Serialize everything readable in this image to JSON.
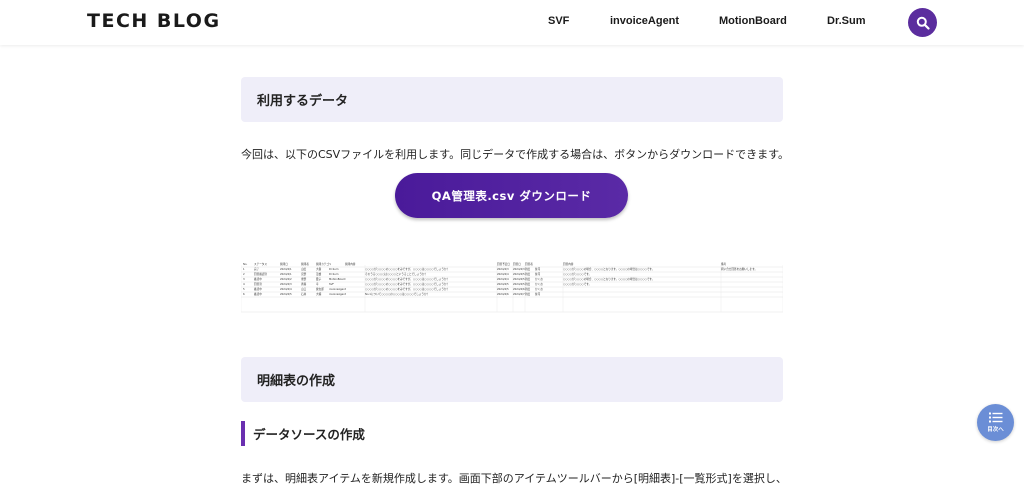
{
  "header": {
    "logo": "TECH BLOG",
    "nav": [
      "SVF",
      "invoiceAgent",
      "MotionBoard",
      "Dr.Sum"
    ],
    "search_icon": "search-icon"
  },
  "sections": {
    "data_used": "利用するデータ",
    "intro": "今回は、以下のCSVファイルを利用します。同じデータで作成する場合は、ボタンからダウンロードできます。",
    "download_button": "QA管理表.csv ダウンロード",
    "detail_table": "明細表の作成",
    "datasource": "データソースの作成",
    "step1": "まずは、明細表アイテムを新規作成します。画面下部のアイテムツールバーから[明細表]-[一覧形式]を選択し、"
  },
  "toc": {
    "label": "目次へ",
    "icon": "list-icon"
  },
  "colors": {
    "accent": "#5b2d9e",
    "section_bg": "#efeef9",
    "toc": "#6b8ed6"
  },
  "spreadsheet": {
    "headers": [
      "No.",
      "ステータス",
      "質問日",
      "質問者",
      "質問カテゴリ",
      "質問内容",
      "回答予定日",
      "回答日",
      "回答者",
      "回答内容",
      "備考"
    ],
    "rows": [
      [
        "1",
        "完了",
        "2024/4/1",
        "山田",
        "大樹",
        "Dr.Sum",
        "○○○○が○○○○の○○○○をみですが、○○○○は○○○○でしょうか？",
        "2024/4/3",
        "2024/4/3",
        "新田",
        "佐司",
        "○○○○が○○○○の場合、○○○○となります。○○○○の場合は○○○○です。",
        "問い合せ回答をお願いします。"
      ],
      [
        "2",
        "回答確認済",
        "2024/4/1",
        "宮野",
        "茂雄",
        "Dr.Sum",
        "そのうる○○○○は○○○○というることでしょうか？",
        "2024/4/4",
        "2024/4/5",
        "新田",
        "佐司",
        "○○○○が○○○○です。",
        ""
      ],
      [
        "3",
        "確認中",
        "2024/4/2",
        "重野",
        "愛子",
        "MotionBoard",
        "○○○○が○○○○の○○○○をみですが、○○○○は○○○○でしょうか？",
        "2024/4/4",
        "2024/4/5",
        "新田",
        "かくお",
        "○○○○が○○○○の場合、○○○○となります。○○○○の場合は○○○○です。",
        ""
      ],
      [
        "4",
        "回答済",
        "2024/4/3",
        "斉藤",
        "幸",
        "SVF",
        "○○○○が○○○○の○○○○をみですが、○○○○は○○○○でしょうか？",
        "2024/4/5",
        "2024/4/5",
        "新田",
        "かくお",
        "○○○○が○○○○です。",
        ""
      ],
      [
        "5",
        "確認中",
        "2024/4/4",
        "山口",
        "健太郎",
        "invoiceAgent",
        "○○○○が○○○○の○○○○をみですが、○○○○は○○○○でしょうか？",
        "2024/4/5",
        "2024/4/6",
        "新田",
        "かくお",
        "",
        ""
      ],
      [
        "6",
        "確認中",
        "2024/4/5",
        "石井",
        "大輔",
        "invoiceAgent",
        "No.1について○○○○の○○○○は○○○○でしょうか？",
        "2024/4/6",
        "2024/4/7",
        "新田",
        "佐司",
        "",
        ""
      ]
    ]
  }
}
